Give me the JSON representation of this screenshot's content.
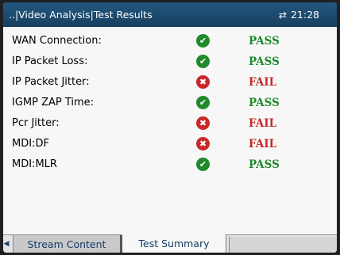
{
  "header": {
    "title": "..|Video Analysis|Test Results",
    "status_icon": "transfer-arrows-icon",
    "time": "21:28"
  },
  "results": [
    {
      "name": "WAN Connection:",
      "status": "pass",
      "verdict": "PASS"
    },
    {
      "name": "IP Packet Loss:",
      "status": "pass",
      "verdict": "PASS"
    },
    {
      "name": "IP Packet Jitter:",
      "status": "fail",
      "verdict": "FAIL"
    },
    {
      "name": "IGMP ZAP Time:",
      "status": "pass",
      "verdict": "PASS"
    },
    {
      "name": "Pcr Jitter:",
      "status": "fail",
      "verdict": "FAIL"
    },
    {
      "name": "MDI:DF",
      "status": "fail",
      "verdict": "FAIL"
    },
    {
      "name": "MDI:MLR",
      "status": "pass",
      "verdict": "PASS"
    }
  ],
  "tabs": {
    "stream_content": "Stream Content",
    "test_summary": "Test Summary",
    "active": "test_summary"
  },
  "colors": {
    "pass": "#1f8a2a",
    "fail": "#c8282a",
    "header": "#1c4a70"
  }
}
